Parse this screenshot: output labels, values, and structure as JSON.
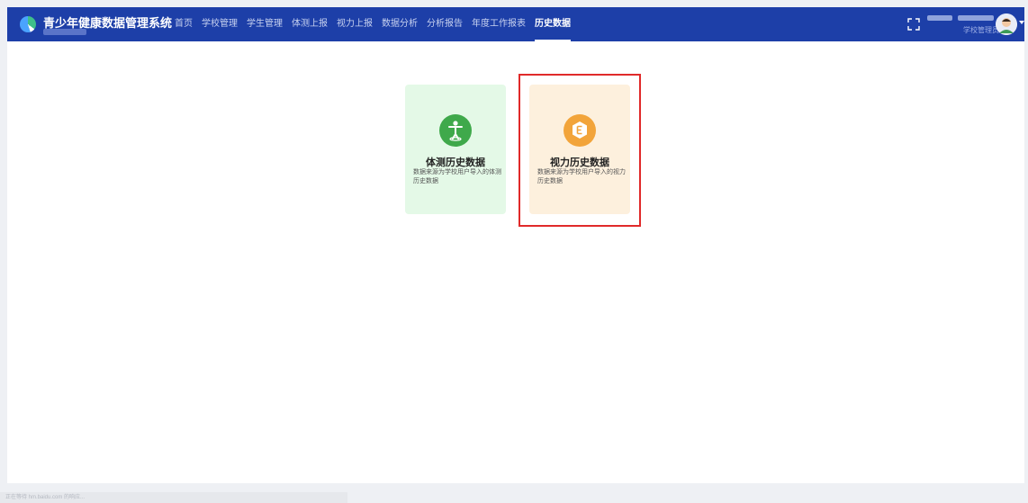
{
  "app": {
    "title": "青少年健康数据管理系统"
  },
  "nav": {
    "items": [
      {
        "label": "首页"
      },
      {
        "label": "学校管理"
      },
      {
        "label": "学生管理"
      },
      {
        "label": "体测上报"
      },
      {
        "label": "视力上报"
      },
      {
        "label": "数据分析"
      },
      {
        "label": "分析报告"
      },
      {
        "label": "年度工作报表"
      },
      {
        "label": "历史数据",
        "active": true
      }
    ]
  },
  "header": {
    "user_role": "学校管理员"
  },
  "cards": [
    {
      "title": "体测历史数据",
      "description": "数据来源为学校用户导入的体测历史数据",
      "icon": "person-icon",
      "color": "#3fa94b",
      "background": "#e4f9e7"
    },
    {
      "title": "视力历史数据",
      "description": "数据来源为学校用户导入的视力历史数据",
      "icon": "hexagon-e-icon",
      "color": "#f2a43a",
      "background": "#fdf0dd"
    }
  ],
  "colors": {
    "header_bg": "#1d3fa8",
    "highlight": "#e02a2a"
  },
  "status_bar": {
    "text": "正在等待 hm.baidu.com 的响应..."
  }
}
